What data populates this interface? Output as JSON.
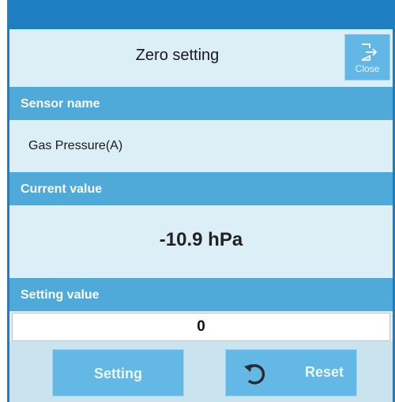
{
  "dialog": {
    "title": "Zero setting",
    "close_label": "Close"
  },
  "sections": {
    "sensor_name_header": "Sensor name",
    "sensor_name_value": "Gas Pressure(A)",
    "current_value_header": "Current value",
    "current_value": "-10.9 hPa",
    "setting_value_header": "Setting value",
    "setting_value": "0"
  },
  "buttons": {
    "setting_label": "Setting",
    "reset_label": "Reset"
  },
  "icons": {
    "close": "exit-door-icon",
    "reset": "undo-arrow-icon"
  },
  "colors": {
    "accent": "#1f7ec2",
    "header": "#4fa9d9",
    "button": "#63b8e6",
    "background": "#dceef6"
  }
}
